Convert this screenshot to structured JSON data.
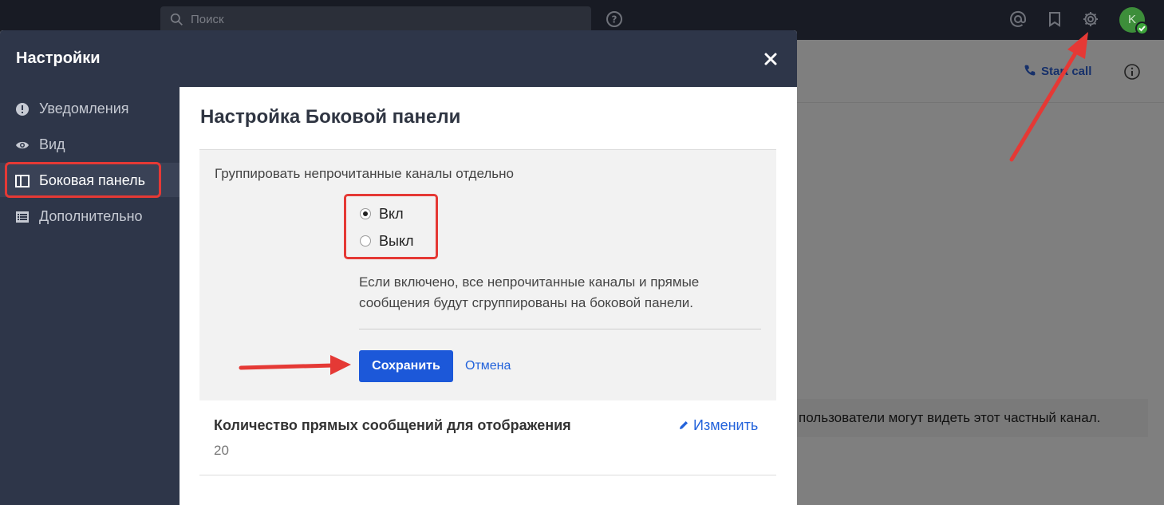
{
  "topbar": {
    "search_placeholder": "Поиск",
    "avatar_initial": "K"
  },
  "background": {
    "call_label": "Start call",
    "notice_text": "пользователи могут видеть этот частный канал."
  },
  "modal": {
    "title": "Настройки",
    "sidebar": {
      "items": [
        {
          "label": "Уведомления",
          "icon": "alert-circle-icon"
        },
        {
          "label": "Вид",
          "icon": "eye-icon"
        },
        {
          "label": "Боковая панель",
          "icon": "sidebar-panel-icon",
          "active": true
        },
        {
          "label": "Дополнительно",
          "icon": "list-icon"
        }
      ]
    },
    "content": {
      "title": "Настройка Боковой панели",
      "group_setting": {
        "label": "Группировать непрочитанные каналы отдельно",
        "options": [
          {
            "label": "Вкл",
            "checked": true
          },
          {
            "label": "Выкл",
            "checked": false
          }
        ],
        "help_line1": "Если включено, все непрочитанные каналы и прямые",
        "help_line2": "сообщения будут сгруппированы на боковой панели.",
        "save_label": "Сохранить",
        "cancel_label": "Отмена"
      },
      "dm_setting": {
        "label": "Количество прямых сообщений для отображения",
        "value": "20",
        "edit_label": "Изменить"
      }
    }
  },
  "colors": {
    "header_bg": "#2e3649",
    "primary_button": "#1c58d9",
    "link": "#2363db",
    "annotation_red": "#e53935"
  }
}
